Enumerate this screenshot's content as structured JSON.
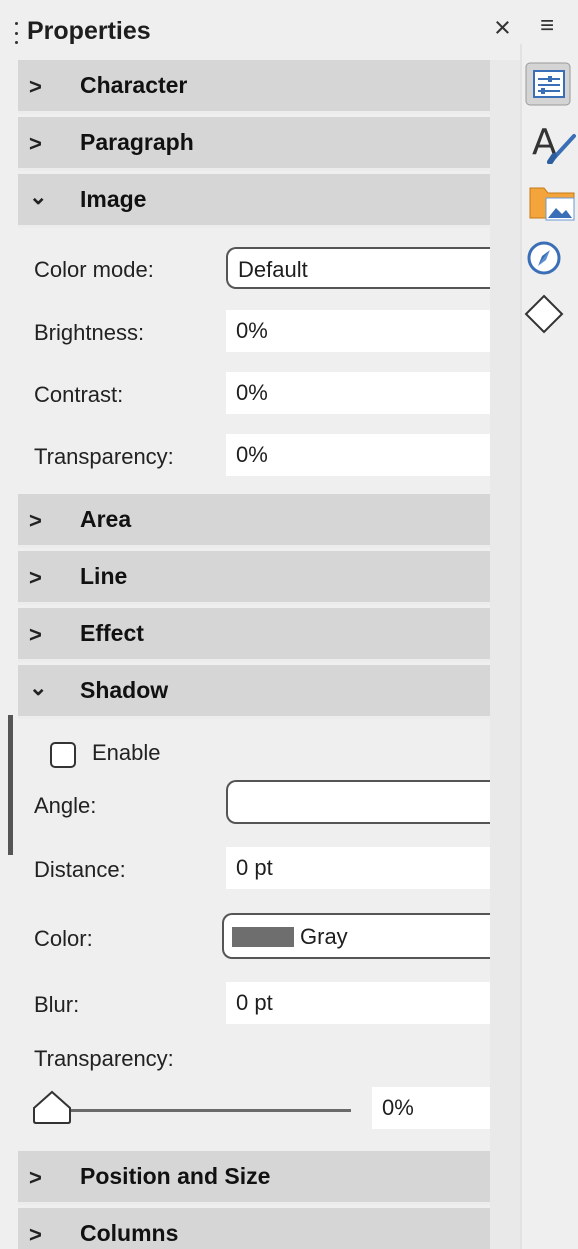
{
  "title": "Properties",
  "sections": {
    "character": "Character",
    "paragraph": "Paragraph",
    "image": "Image",
    "area": "Area",
    "line": "Line",
    "effect": "Effect",
    "shadow": "Shadow",
    "position_size": "Position and Size",
    "columns": "Columns"
  },
  "chevrons": {
    "collapsed": ">",
    "expanded": "⌄"
  },
  "image": {
    "color_mode_label": "Color mode:",
    "color_mode_value": "Default",
    "brightness_label": "Brightness:",
    "brightness_value": "0%",
    "contrast_label": "Contrast:",
    "contrast_value": "0%",
    "transparency_label": "Transparency:",
    "transparency_value": "0%"
  },
  "shadow": {
    "enable_label": "Enable",
    "enable_checked": false,
    "angle_label": "Angle:",
    "angle_value": "",
    "distance_label": "Distance:",
    "distance_value": "0 pt",
    "color_label": "Color:",
    "color_value": "Gray",
    "color_swatch": "#6e6e6e",
    "blur_label": "Blur:",
    "blur_value": "0 pt",
    "transparency_label": "Transparency:",
    "transparency_value": "0%",
    "transparency_slider_fraction": 0
  },
  "close_symbol": "×",
  "menu_symbol": "≡",
  "sidebar_icons": [
    "properties-icon",
    "styles-icon",
    "gallery-icon",
    "navigator-icon",
    "shapes-icon"
  ]
}
